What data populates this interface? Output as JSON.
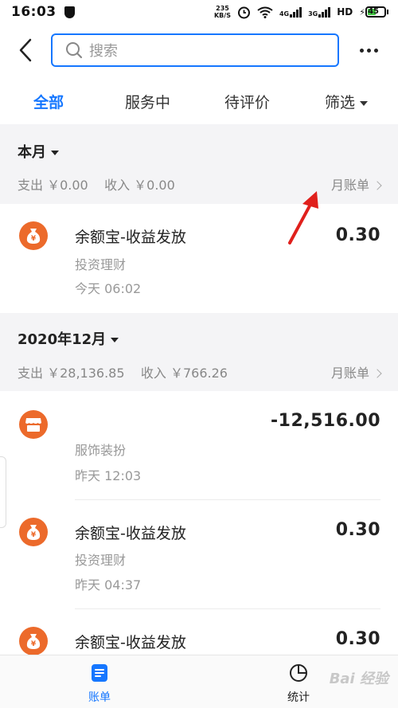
{
  "status": {
    "time": "16:03",
    "net_speed": "235",
    "net_unit": "KB/S",
    "sig1": "4G",
    "sig2": "3G",
    "hd": "HD",
    "battery": "45"
  },
  "search": {
    "placeholder": "搜索"
  },
  "tabs": [
    {
      "label": "全部",
      "active": true
    },
    {
      "label": "服务中"
    },
    {
      "label": "待评价"
    },
    {
      "label": "筛选"
    }
  ],
  "sections": [
    {
      "month": "本月",
      "expense": "支出 ￥0.00",
      "income": "收入 ￥0.00",
      "monthly_bill": "月账单",
      "records": [
        {
          "icon": "money-bag-icon",
          "title": "余额宝-收益发放",
          "category": "投资理财",
          "time": "今天  06:02",
          "amount": "0.30"
        }
      ]
    },
    {
      "month": "2020年12月",
      "expense": "支出 ￥28,136.85",
      "income": "收入 ￥766.26",
      "monthly_bill": "月账单",
      "records": [
        {
          "icon": "store-icon",
          "title": "",
          "category": "服饰装扮",
          "time": "昨天  12:03",
          "amount": "-12,516.00"
        },
        {
          "icon": "money-bag-icon",
          "title": "余额宝-收益发放",
          "category": "投资理财",
          "time": "昨天  04:37",
          "amount": "0.30"
        },
        {
          "icon": "money-bag-icon",
          "title": "余额宝-收益发放",
          "category": "",
          "time": "",
          "amount": "0.30"
        }
      ]
    }
  ],
  "bottom_nav": [
    {
      "label": "账单",
      "active": true
    },
    {
      "label": "统计"
    }
  ],
  "watermark": "Bai 经验",
  "colors": {
    "accent": "#1677ff",
    "icon_orange": "#ec6a2b",
    "arrow": "#e0201c"
  }
}
